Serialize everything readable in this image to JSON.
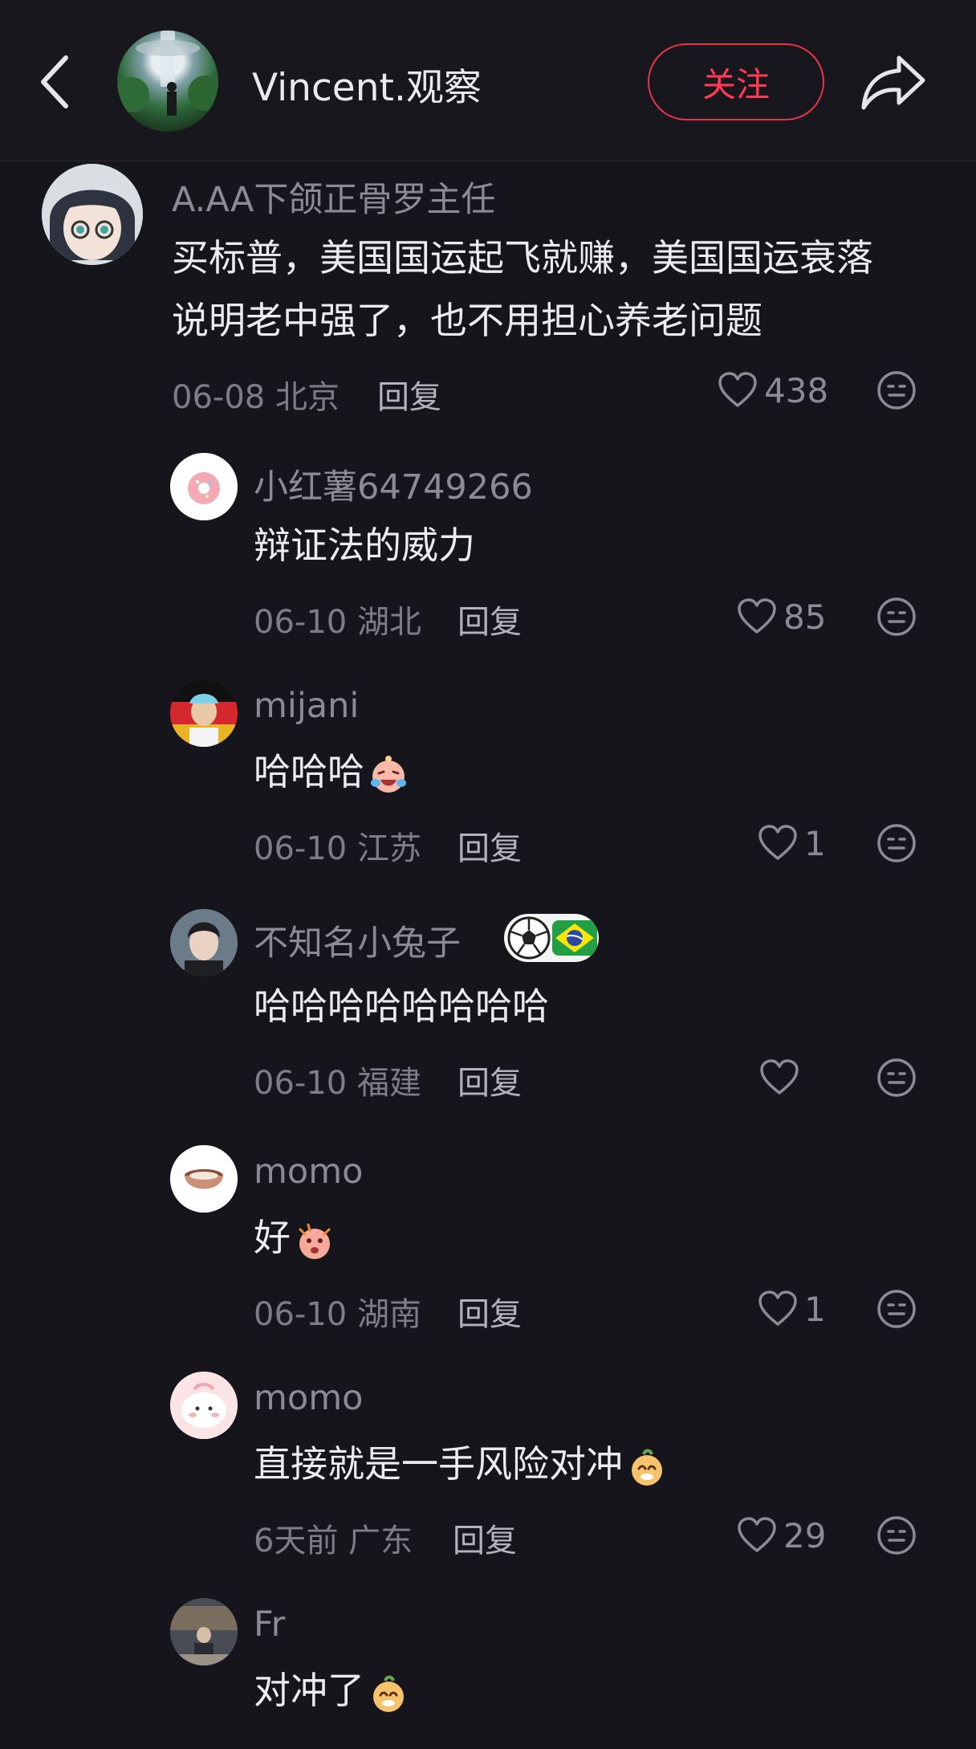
{
  "header": {
    "username": "Vincent.观察",
    "follow_label": "关注",
    "back_icon": "chevron-left-icon",
    "share_icon": "share-arrow-icon",
    "accent": "#e8344b"
  },
  "comments": [
    {
      "name": "A.AA下颌正骨罗主任",
      "text_line1": "买标普，美国国运起飞就赚，美国国运衰落",
      "text_line2": "说明老中强了，也不用担心养老问题",
      "meta": "06-08 北京",
      "reply": "回复",
      "likes": "438"
    },
    {
      "name": "小红薯64749266",
      "text": "辩证法的威力",
      "meta": "06-10 湖北",
      "reply": "回复",
      "likes": "85"
    },
    {
      "name": "mijani",
      "text": "哈哈哈",
      "meta": "06-10 江苏",
      "reply": "回复",
      "likes": "1"
    },
    {
      "name": "不知名小兔子",
      "text": "哈哈哈哈哈哈哈哈",
      "meta": "06-10 福建",
      "reply": "回复",
      "likes": ""
    },
    {
      "name": "momo",
      "text": "好",
      "meta": "06-10 湖南",
      "reply": "回复",
      "likes": "1"
    },
    {
      "name": "momo",
      "text": "直接就是一手风险对冲",
      "meta": "6天前 广东",
      "reply": "回复",
      "likes": "29"
    },
    {
      "name": "Fr",
      "text": "对冲了"
    }
  ]
}
